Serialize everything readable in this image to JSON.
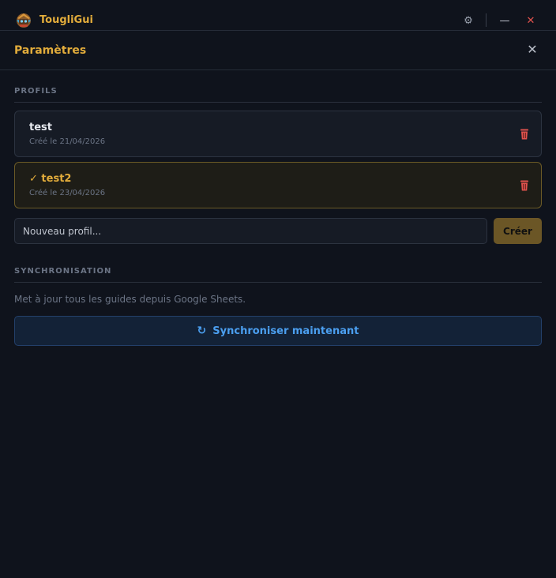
{
  "app": {
    "title": "TougliGui"
  },
  "window_controls": {
    "settings_icon": "⚙",
    "minimize_icon": "—",
    "close_icon": "✕"
  },
  "panel": {
    "title": "Paramètres",
    "close_icon": "✕"
  },
  "profiles_section": {
    "label": "PROFILS",
    "profiles": [
      {
        "name": "test",
        "created": "Créé le 21/04/2026",
        "active": false
      },
      {
        "name": "✓ test2",
        "created": "Créé le 23/04/2026",
        "active": true
      }
    ],
    "new_profile_placeholder": "Nouveau profil...",
    "create_label": "Créer"
  },
  "sync_section": {
    "label": "SYNCHRONISATION",
    "description": "Met à jour tous les guides depuis Google Sheets.",
    "button_icon": "↻",
    "button_label": "Synchroniser maintenant"
  },
  "colors": {
    "accent": "#e2ac3b",
    "background": "#0f131c",
    "danger": "#e0524d",
    "sync_blue": "#4b9ff0"
  }
}
